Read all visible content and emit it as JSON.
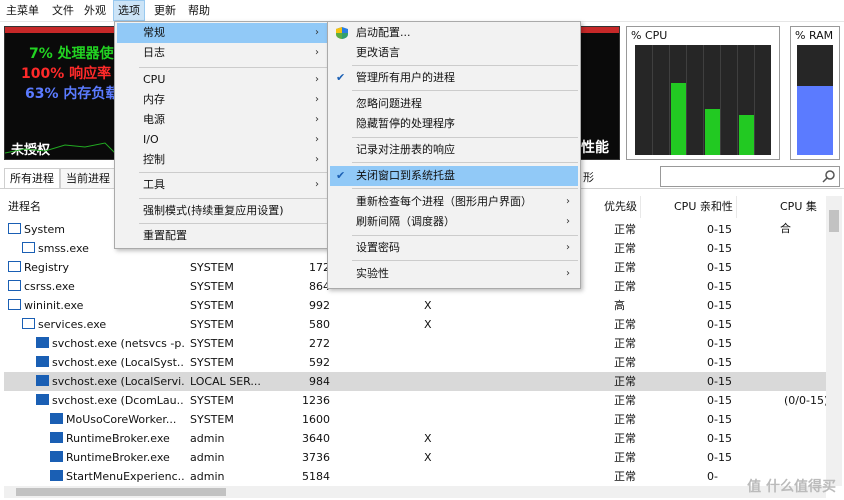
{
  "menubar": {
    "items": [
      "主菜单",
      "文件",
      "外观",
      "选项",
      "更新",
      "帮助"
    ]
  },
  "dashboard": {
    "lines": [
      "7% 处理器使",
      "100% 响应率",
      "63% 内存负载"
    ],
    "unlicensed": "未授权",
    "perf_fragment": "性能",
    "cpu_graph_title": "% CPU",
    "ram_graph_title": "% RAM",
    "ram_usage": 0.63,
    "colors": {
      "line1": "#22d322",
      "line2": "#ff2a2a",
      "line3": "#5b7bff"
    }
  },
  "tabs": [
    "所有进程",
    "当前进程"
  ],
  "tab_fragment": "形",
  "columns": {
    "name": "进程名",
    "priority": "优先级",
    "affinity": "CPU 亲和性",
    "cpu_set": "CPU 集合"
  },
  "rows": [
    {
      "name": "System",
      "user": "",
      "pid": "",
      "c4": "",
      "priority": "正常",
      "affinity": "0-15",
      "set": "",
      "indent": 0
    },
    {
      "name": "smss.exe",
      "user": "",
      "pid": "",
      "c4": "",
      "priority": "正常",
      "affinity": "0-15",
      "set": "",
      "indent": 1
    },
    {
      "name": "Registry",
      "user": "SYSTEM",
      "pid": "172",
      "c4": "",
      "priority": "正常",
      "affinity": "0-15",
      "set": "",
      "indent": 0
    },
    {
      "name": "csrss.exe",
      "user": "SYSTEM",
      "pid": "864",
      "c4": "",
      "priority": "正常",
      "affinity": "0-15",
      "set": "",
      "indent": 0
    },
    {
      "name": "wininit.exe",
      "user": "SYSTEM",
      "pid": "992",
      "c4": "X",
      "priority": "高",
      "affinity": "0-15",
      "set": "",
      "indent": 0
    },
    {
      "name": "services.exe",
      "user": "SYSTEM",
      "pid": "580",
      "c4": "X",
      "priority": "正常",
      "affinity": "0-15",
      "set": "",
      "indent": 1
    },
    {
      "name": "svchost.exe (netsvcs -p...",
      "user": "SYSTEM",
      "pid": "272",
      "c4": "",
      "priority": "正常",
      "affinity": "0-15",
      "set": "",
      "indent": 2
    },
    {
      "name": "svchost.exe (LocalSyst...",
      "user": "SYSTEM",
      "pid": "592",
      "c4": "",
      "priority": "正常",
      "affinity": "0-15",
      "set": "",
      "indent": 2
    },
    {
      "name": "svchost.exe (LocalServi...",
      "user": "LOCAL SER...",
      "pid": "984",
      "c4": "",
      "priority": "正常",
      "affinity": "0-15",
      "set": "",
      "indent": 2,
      "selected": true
    },
    {
      "name": "svchost.exe (DcomLau...",
      "user": "SYSTEM",
      "pid": "1236",
      "c4": "",
      "priority": "正常",
      "affinity": "0-15",
      "set": "(0/0-15)",
      "indent": 2
    },
    {
      "name": "MoUsoCoreWorker...",
      "user": "SYSTEM",
      "pid": "1600",
      "c4": "",
      "priority": "正常",
      "affinity": "0-15",
      "set": "",
      "indent": 3
    },
    {
      "name": "RuntimeBroker.exe",
      "user": "admin",
      "pid": "3640",
      "c4": "X",
      "priority": "正常",
      "affinity": "0-15",
      "set": "",
      "indent": 3
    },
    {
      "name": "RuntimeBroker.exe",
      "user": "admin",
      "pid": "3736",
      "c4": "X",
      "priority": "正常",
      "affinity": "0-15",
      "set": "",
      "indent": 3
    },
    {
      "name": "StartMenuExperienc...",
      "user": "admin",
      "pid": "5184",
      "c4": "",
      "priority": "正常",
      "affinity": "0-",
      "set": "",
      "indent": 3
    }
  ],
  "options_menu": {
    "items": [
      "常规",
      "日志",
      "CPU",
      "内存",
      "电源",
      "I/O",
      "控制",
      "工具",
      "强制模式(持续重复应用设置)",
      "重置配置"
    ]
  },
  "general_submenu": {
    "items": [
      "启动配置...",
      "更改语言",
      "管理所有用户的进程",
      "忽略问题进程",
      "隐藏暂停的处理程序",
      "记录对注册表的响应",
      "关闭窗口到系统托盘",
      "重新检查每个进程（图形用户界面）",
      "刷新间隔（调度器）",
      "设置密码",
      "实验性"
    ]
  },
  "watermark": "值 什么值得买"
}
